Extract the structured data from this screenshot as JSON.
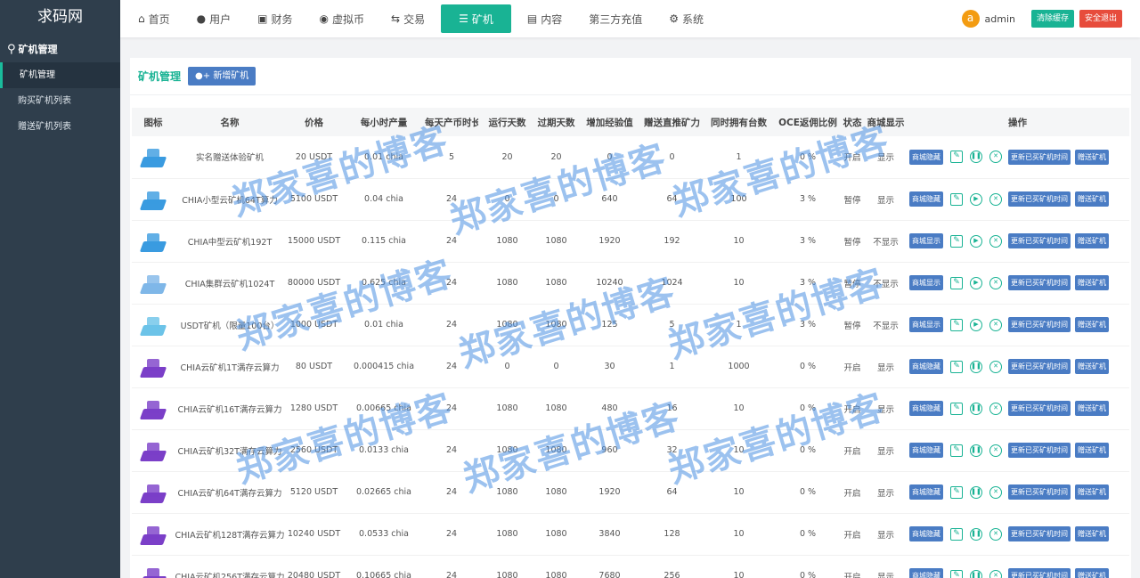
{
  "sidebar": {
    "brand": "求码网",
    "section": "矿机管理",
    "items": [
      {
        "label": "矿机管理",
        "active": true
      },
      {
        "label": "购买矿机列表",
        "active": false
      },
      {
        "label": "赠送矿机列表",
        "active": false
      }
    ]
  },
  "topnav": {
    "items": [
      {
        "label": "首页",
        "icon": "home-icon"
      },
      {
        "label": "用户",
        "icon": "user-icon"
      },
      {
        "label": "财务",
        "icon": "finance-icon"
      },
      {
        "label": "虚拟币",
        "icon": "coin-icon"
      },
      {
        "label": "交易",
        "icon": "exchange-icon"
      },
      {
        "label": "矿机",
        "icon": "server-icon",
        "active": true
      },
      {
        "label": "内容",
        "icon": "content-icon"
      },
      {
        "label": "第三方充值",
        "icon": ""
      },
      {
        "label": "系统",
        "icon": "gear-icon"
      }
    ],
    "avatar_letter": "a",
    "username": "admin",
    "clear_cache": "清除缓存",
    "logout": "安全退出"
  },
  "panel": {
    "title": "矿机管理",
    "add_button": "新增矿机"
  },
  "table": {
    "headers": [
      "图标",
      "名称",
      "价格",
      "每小时产量",
      "每天产币时长",
      "运行天数",
      "过期天数",
      "增加经验值",
      "赠送直推矿力",
      "同时拥有台数",
      "OCE返佣比例",
      "状态",
      "商城显示",
      "操作"
    ],
    "rows": [
      {
        "icon_color": "#3a9be0",
        "name": "实名赠送体验矿机",
        "price": "20 USDT",
        "hourly": "0.01 chia",
        "hours": "5",
        "run_days": "20",
        "expire_days": "20",
        "exp": "0",
        "gift_power": "0",
        "own_count": "1",
        "oce": "0 %",
        "status": "开启",
        "mall": "显示",
        "mall_btn": "商城隐藏",
        "toggle_icon": "pause"
      },
      {
        "icon_color": "#3a9be0",
        "name": "CHIA小型云矿机64T算力",
        "price": "5100 USDT",
        "hourly": "0.04 chia",
        "hours": "24",
        "run_days": "0",
        "expire_days": "0",
        "exp": "640",
        "gift_power": "64",
        "own_count": "100",
        "oce": "3 %",
        "status": "暂停",
        "mall": "显示",
        "mall_btn": "商城隐藏",
        "toggle_icon": "play"
      },
      {
        "icon_color": "#3a9be0",
        "name": "CHIA中型云矿机192T",
        "price": "15000 USDT",
        "hourly": "0.115 chia",
        "hours": "24",
        "run_days": "1080",
        "expire_days": "1080",
        "exp": "1920",
        "gift_power": "192",
        "own_count": "10",
        "oce": "3 %",
        "status": "暂停",
        "mall": "不显示",
        "mall_btn": "商城显示",
        "toggle_icon": "play"
      },
      {
        "icon_color": "#7fb7e8",
        "name": "CHIA集群云矿机1024T",
        "price": "80000 USDT",
        "hourly": "0.625 chia",
        "hours": "24",
        "run_days": "1080",
        "expire_days": "1080",
        "exp": "10240",
        "gift_power": "1024",
        "own_count": "10",
        "oce": "3 %",
        "status": "暂停",
        "mall": "不显示",
        "mall_btn": "商城显示",
        "toggle_icon": "play"
      },
      {
        "icon_color": "#6cc3e8",
        "name": "USDT矿机（限量100台）",
        "price": "1000 USDT",
        "hourly": "0.01 chia",
        "hours": "24",
        "run_days": "1080",
        "expire_days": "1080",
        "exp": "125",
        "gift_power": "5",
        "own_count": "1",
        "oce": "3 %",
        "status": "暂停",
        "mall": "不显示",
        "mall_btn": "商城显示",
        "toggle_icon": "play"
      },
      {
        "icon_color": "#7b3fc8",
        "name": "CHIA云矿机1T满存云算力",
        "price": "80 USDT",
        "hourly": "0.000415 chia",
        "hours": "24",
        "run_days": "0",
        "expire_days": "0",
        "exp": "30",
        "gift_power": "1",
        "own_count": "1000",
        "oce": "0 %",
        "status": "开启",
        "mall": "显示",
        "mall_btn": "商城隐藏",
        "toggle_icon": "pause"
      },
      {
        "icon_color": "#7b3fc8",
        "name": "CHIA云矿机16T满存云算力",
        "price": "1280 USDT",
        "hourly": "0.00665 chia",
        "hours": "24",
        "run_days": "1080",
        "expire_days": "1080",
        "exp": "480",
        "gift_power": "16",
        "own_count": "10",
        "oce": "0 %",
        "status": "开启",
        "mall": "显示",
        "mall_btn": "商城隐藏",
        "toggle_icon": "pause"
      },
      {
        "icon_color": "#7b3fc8",
        "name": "CHIA云矿机32T满存云算力",
        "price": "2560 USDT",
        "hourly": "0.0133 chia",
        "hours": "24",
        "run_days": "1080",
        "expire_days": "1080",
        "exp": "960",
        "gift_power": "32",
        "own_count": "10",
        "oce": "0 %",
        "status": "开启",
        "mall": "显示",
        "mall_btn": "商城隐藏",
        "toggle_icon": "pause"
      },
      {
        "icon_color": "#7b3fc8",
        "name": "CHIA云矿机64T满存云算力",
        "price": "5120 USDT",
        "hourly": "0.02665 chia",
        "hours": "24",
        "run_days": "1080",
        "expire_days": "1080",
        "exp": "1920",
        "gift_power": "64",
        "own_count": "10",
        "oce": "0 %",
        "status": "开启",
        "mall": "显示",
        "mall_btn": "商城隐藏",
        "toggle_icon": "pause"
      },
      {
        "icon_color": "#7b3fc8",
        "name": "CHIA云矿机128T满存云算力",
        "price": "10240 USDT",
        "hourly": "0.0533 chia",
        "hours": "24",
        "run_days": "1080",
        "expire_days": "1080",
        "exp": "3840",
        "gift_power": "128",
        "own_count": "10",
        "oce": "0 %",
        "status": "开启",
        "mall": "显示",
        "mall_btn": "商城隐藏",
        "toggle_icon": "pause"
      },
      {
        "icon_color": "#7b3fc8",
        "name": "CHIA云矿机256T满存云算力",
        "price": "20480 USDT",
        "hourly": "0.10665 chia",
        "hours": "24",
        "run_days": "1080",
        "expire_days": "1080",
        "exp": "7680",
        "gift_power": "256",
        "own_count": "10",
        "oce": "0 %",
        "status": "开启",
        "mall": "显示",
        "mall_btn": "商城隐藏",
        "toggle_icon": "pause"
      }
    ],
    "op_update": "更新已买矿机时间",
    "op_gift": "赠送矿机"
  },
  "watermark": "郑家喜的博客"
}
